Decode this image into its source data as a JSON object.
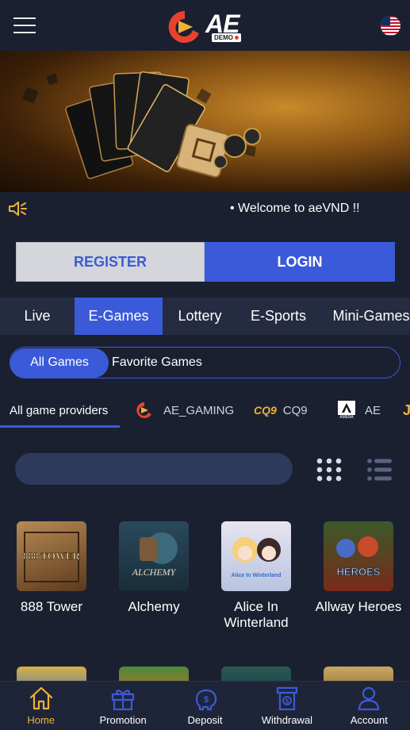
{
  "header": {
    "logo_text": "AE",
    "demo_badge": "DEMO"
  },
  "marquee": {
    "text": "• Welcome to aeVND !!"
  },
  "auth": {
    "register_label": "REGISTER",
    "login_label": "LOGIN"
  },
  "category_tabs": [
    {
      "label": "Live",
      "active": false
    },
    {
      "label": "E-Games",
      "active": true
    },
    {
      "label": "Lottery",
      "active": false
    },
    {
      "label": "E-Sports",
      "active": false
    },
    {
      "label": "Mini-Games",
      "active": false
    }
  ],
  "segment": {
    "all_label": "All Games",
    "favorite_label": "Favorite Games",
    "selected": "All Games"
  },
  "providers": [
    {
      "label": "All game providers",
      "active": true
    },
    {
      "label": "AE_GAMING",
      "icon": "ae-gaming-logo-icon"
    },
    {
      "label": "CQ9",
      "logo_text": "CQ9",
      "icon": "cq9-logo-icon"
    },
    {
      "label": "AE",
      "logo_text": "AMEBA",
      "icon": "ameba-logo-icon"
    }
  ],
  "search": {
    "placeholder": ""
  },
  "games": [
    {
      "name": "888 Tower",
      "thumb_text": "888 TOWER"
    },
    {
      "name": "Alchemy",
      "thumb_text": "ALCHEMY"
    },
    {
      "name": "Alice In Winterland",
      "thumb_text": "Alice In Winterland"
    },
    {
      "name": "Allway Heroes",
      "thumb_text": "HEROES"
    }
  ],
  "bottom_nav": [
    {
      "label": "Home",
      "icon": "home-icon",
      "active": true
    },
    {
      "label": "Promotion",
      "icon": "gift-icon",
      "active": false
    },
    {
      "label": "Deposit",
      "icon": "piggy-bank-icon",
      "active": false
    },
    {
      "label": "Withdrawal",
      "icon": "withdrawal-icon",
      "active": false
    },
    {
      "label": "Account",
      "icon": "user-icon",
      "active": false
    }
  ],
  "colors": {
    "background": "#1b2030",
    "accent": "#3b5ad9",
    "active_nav": "#f1b232",
    "logo_orange": "#e8422d"
  }
}
